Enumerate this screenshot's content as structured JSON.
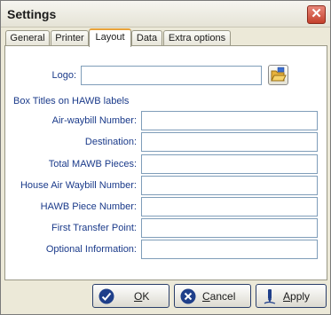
{
  "window": {
    "title": "Settings"
  },
  "tabs": [
    {
      "label": "General"
    },
    {
      "label": "Printer"
    },
    {
      "label": "Layout",
      "active": true
    },
    {
      "label": "Data"
    },
    {
      "label": "Extra options"
    }
  ],
  "layout": {
    "logo_label": "Logo:",
    "logo_value": "",
    "section_title": "Box Titles on HAWB labels",
    "fields": [
      {
        "label": "Air-waybill Number:",
        "value": ""
      },
      {
        "label": "Destination:",
        "value": ""
      },
      {
        "label": "Total MAWB Pieces:",
        "value": ""
      },
      {
        "label": "House Air Waybill Number:",
        "value": ""
      },
      {
        "label": "HAWB Piece Number:",
        "value": ""
      },
      {
        "label": "First Transfer Point:",
        "value": ""
      },
      {
        "label": "Optional Information:",
        "value": ""
      }
    ]
  },
  "buttons": {
    "ok": {
      "hotkey": "O",
      "rest": "K"
    },
    "cancel": {
      "hotkey": "C",
      "rest": "ancel"
    },
    "apply": {
      "hotkey": "A",
      "rest": "pply"
    }
  },
  "icons": {
    "close": "close-icon",
    "folder": "folder-open-icon",
    "ok": "checkmark-icon",
    "cancel": "x-circle-icon",
    "apply": "pen-icon"
  },
  "colors": {
    "label_text": "#1a3a8a",
    "close_button": "#c4402c",
    "active_tab_accent": "#e8a23a",
    "field_border": "#7f9db9"
  }
}
